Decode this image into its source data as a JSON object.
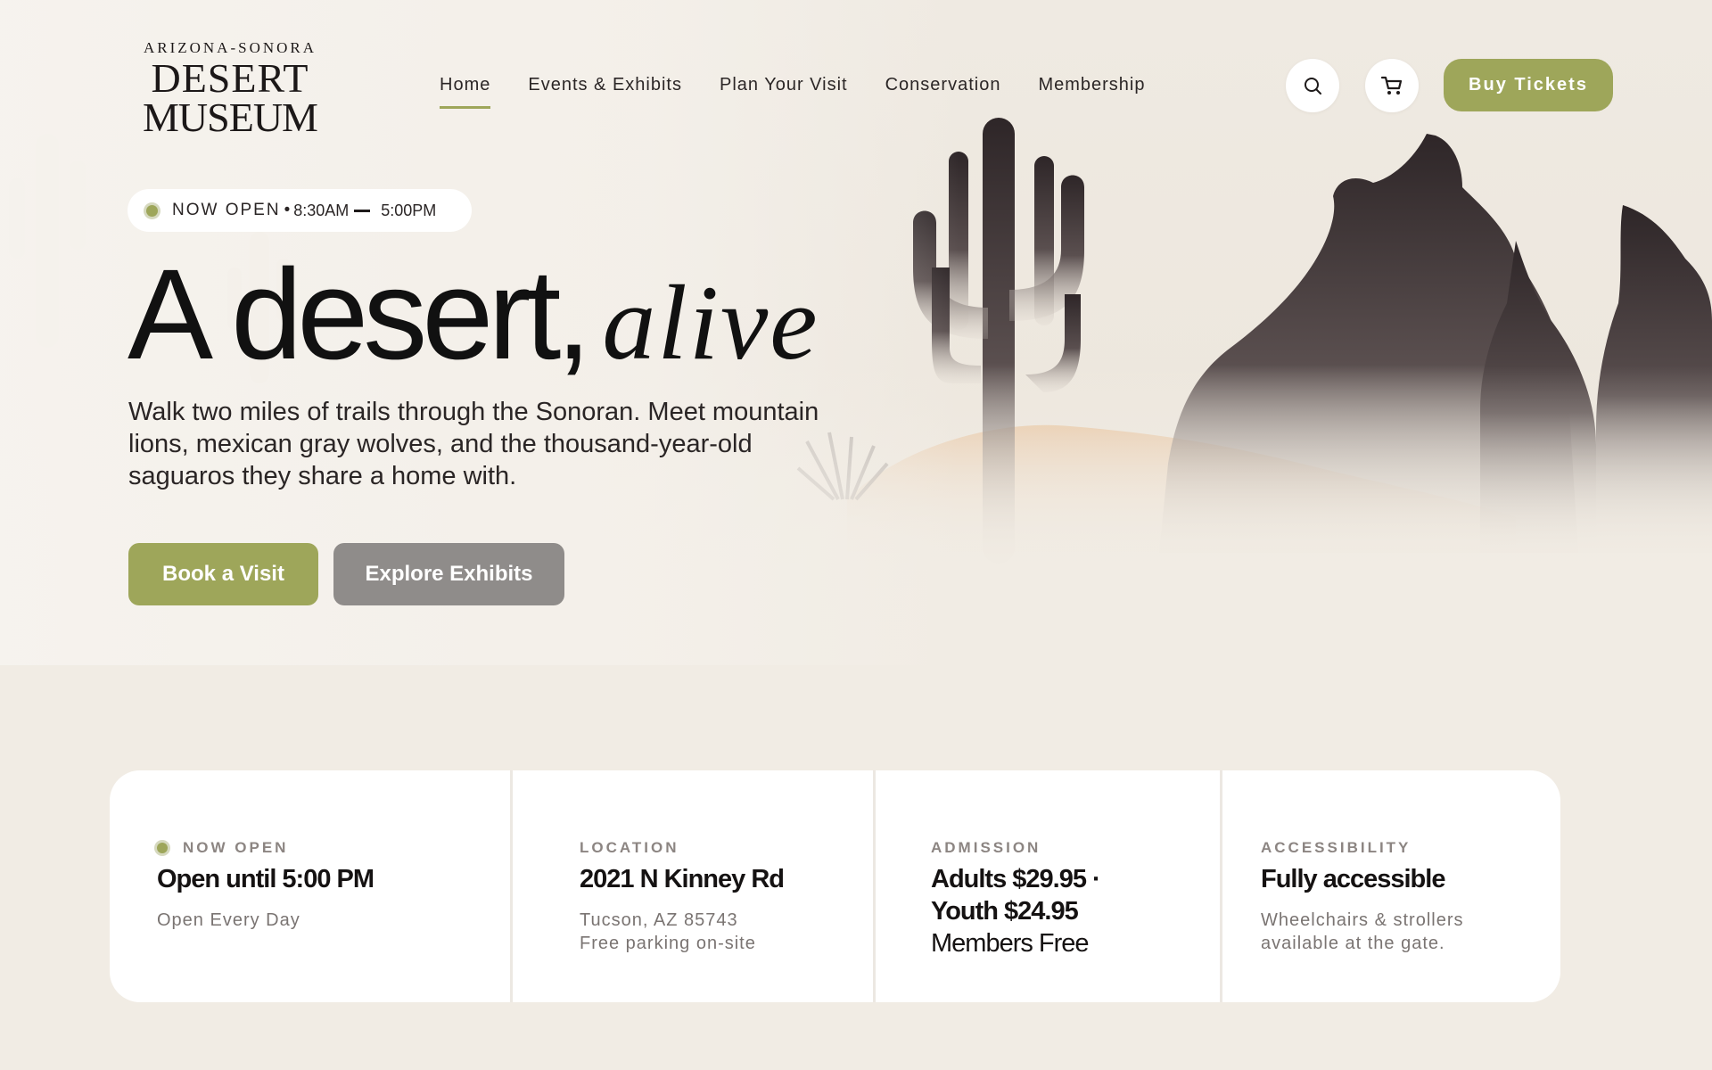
{
  "logo": {
    "line1": "ARIZONA-SONORA",
    "line2": "DESERT",
    "line3": "MUSEUM"
  },
  "nav": {
    "items": [
      "Home",
      "Events & Exhibits",
      "Plan Your Visit",
      "Conservation",
      "Membership"
    ],
    "active": "Home"
  },
  "header": {
    "search_icon": "search-icon",
    "cart_icon": "cart-icon",
    "buy_label": "Buy Tickets"
  },
  "hero": {
    "status_label": "NOW OPEN",
    "separator": "•",
    "open_time": "8:30AM",
    "close_time": "5:00PM",
    "headline_main": "A desert,",
    "headline_accent": "alive",
    "description": "Walk two miles of trails through the Sonoran. Meet mountain lions,  mexican gray wolves, and the thousand-year-old saguaros they share a  home with.",
    "primary_cta": "Book a Visit",
    "secondary_cta": "Explore Exhibits"
  },
  "info": {
    "hours": {
      "label": "NOW OPEN",
      "main": "Open until 5:00 PM",
      "sub": "Open Every Day"
    },
    "location": {
      "label": "LOCATION",
      "main": "2021 N Kinney Rd",
      "sub1": "Tucson, AZ 85743",
      "sub2": "Free parking on-site"
    },
    "admission": {
      "label": "ADMISSION",
      "main1": "Adults $29.95 ·",
      "main2": "Youth $24.95",
      "main3": "Members Free"
    },
    "accessibility": {
      "label": "ACCESSIBILITY",
      "main": "Fully accessible",
      "sub1": "Wheelchairs & strollers",
      "sub2": "available at the gate."
    }
  },
  "colors": {
    "accent": "#9ea65a",
    "secondary_button": "#8f8c8a",
    "page_background": "#f1ece4",
    "silhouette": "#2e2628",
    "sand": "#e9c9a7"
  }
}
